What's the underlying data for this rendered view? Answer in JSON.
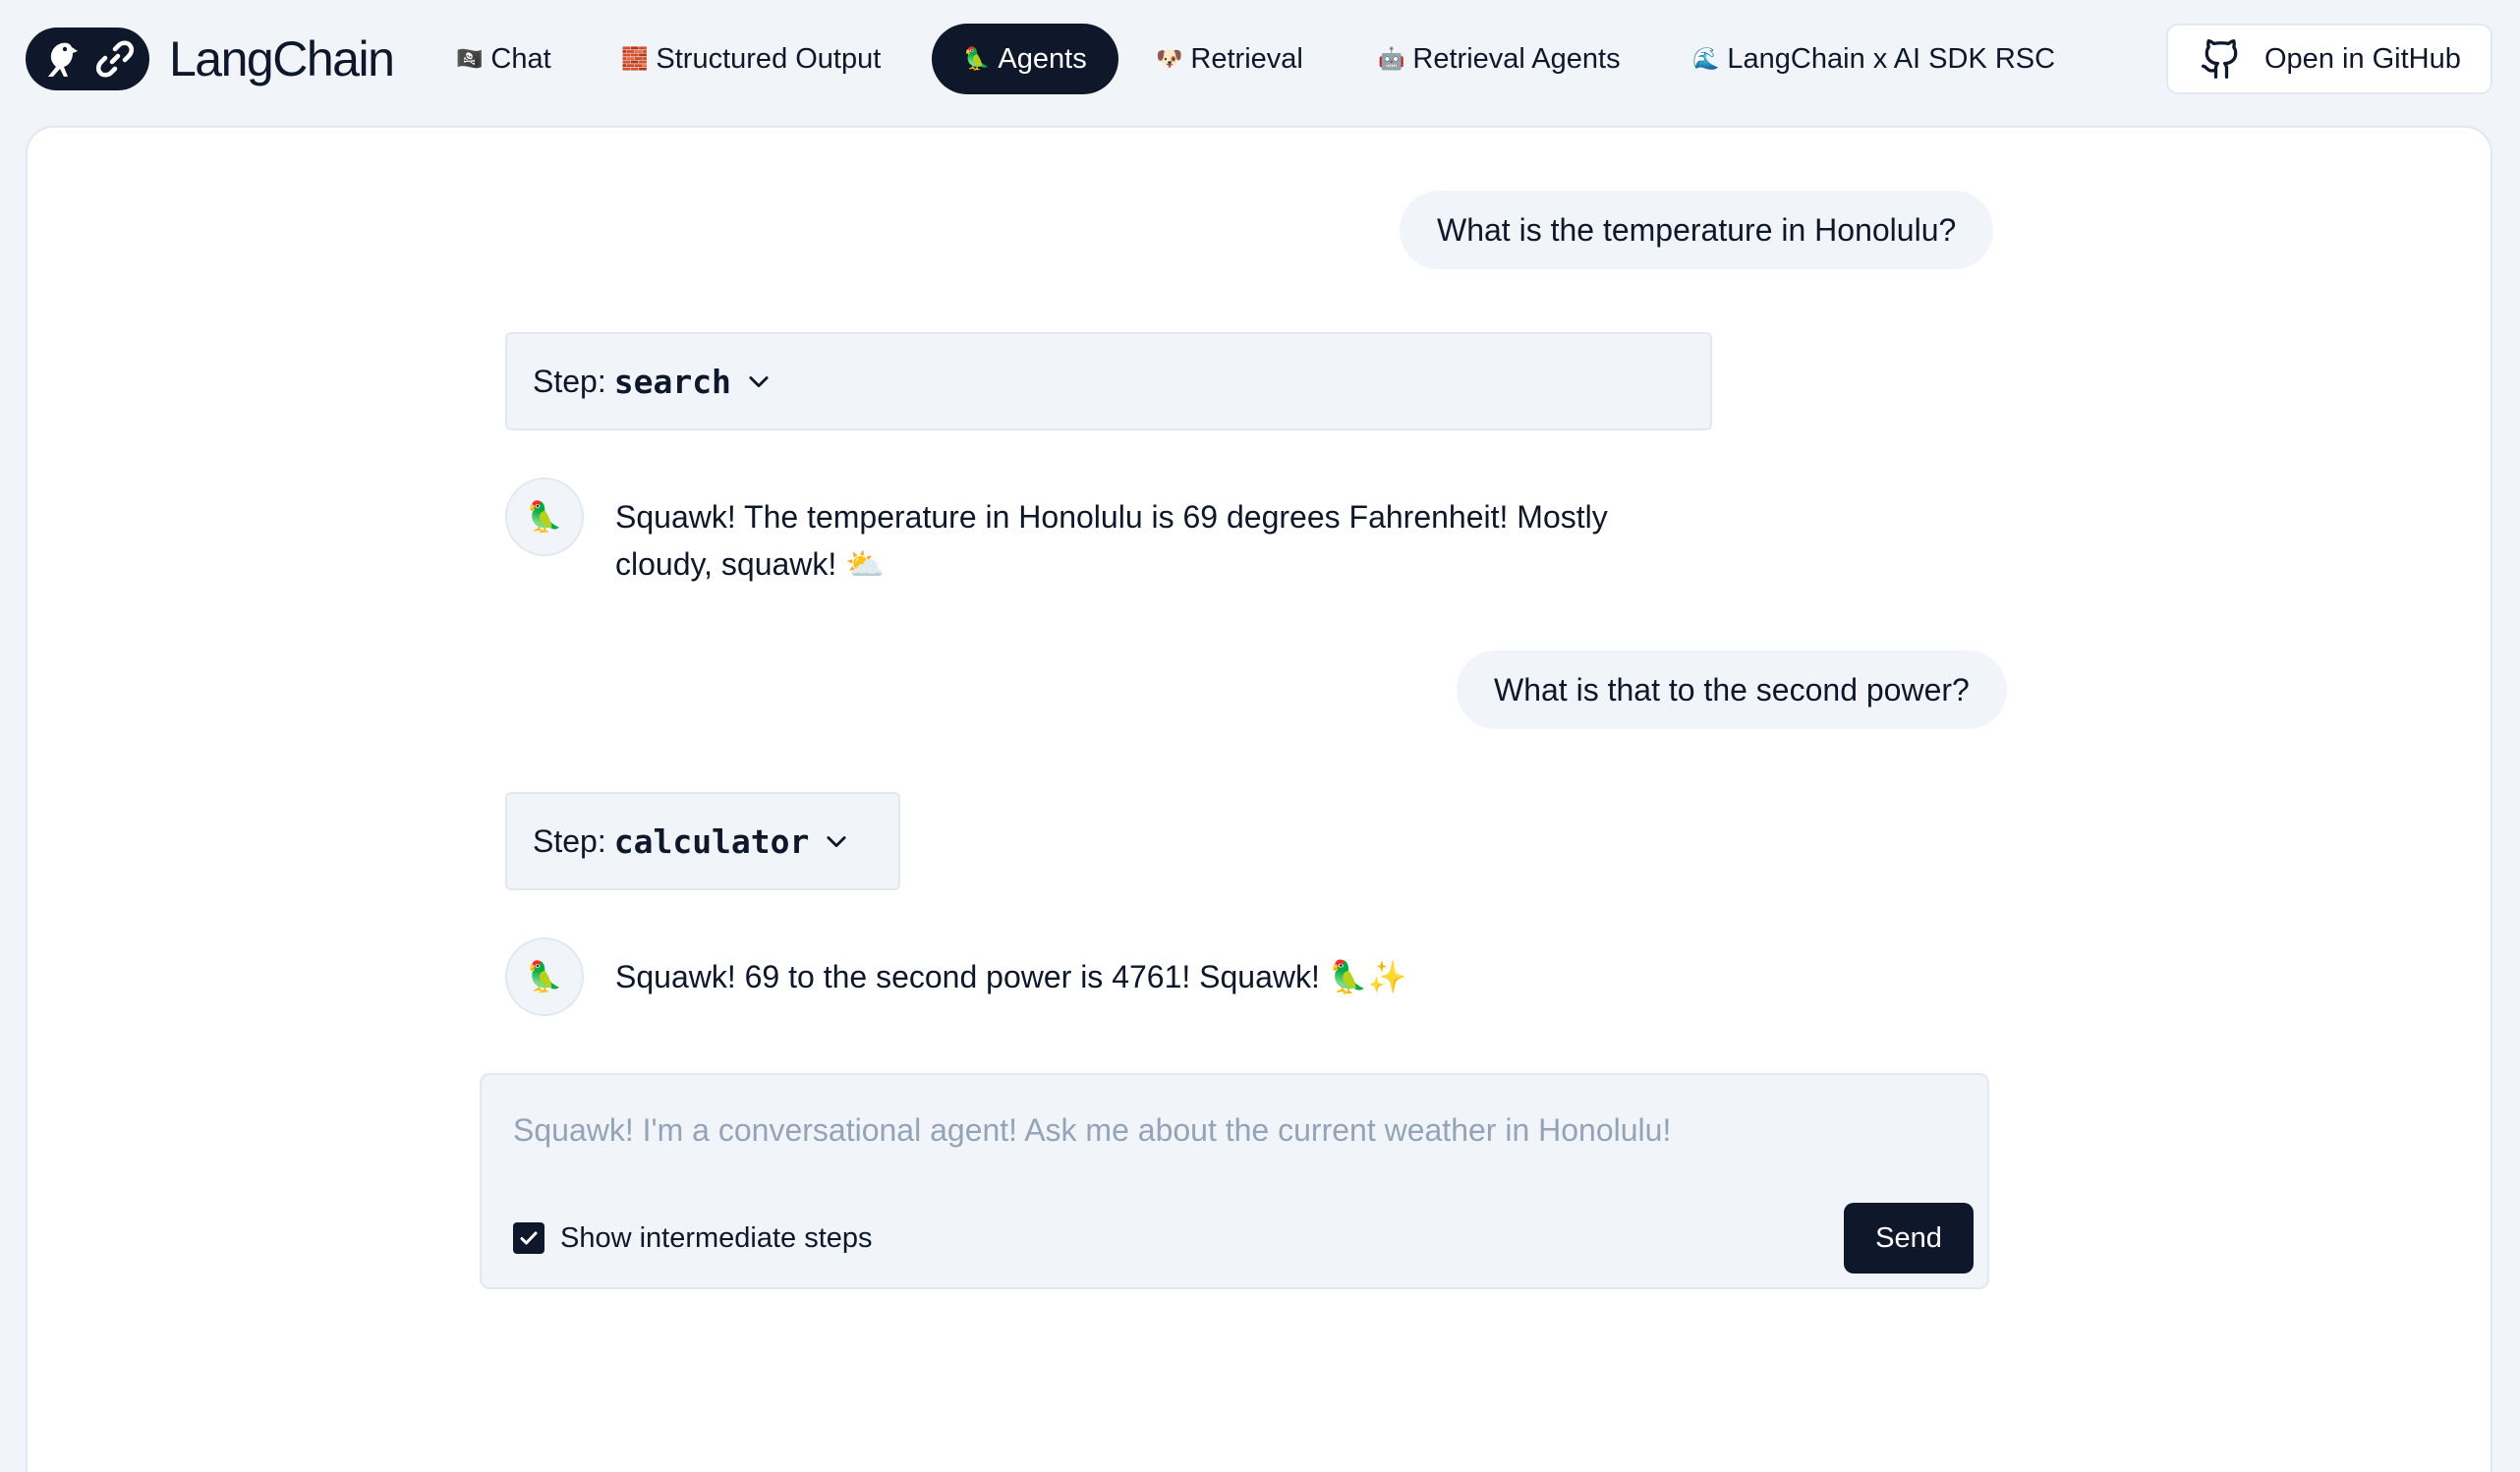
{
  "brand": {
    "name": "LangChain"
  },
  "nav": {
    "items": [
      {
        "emoji": "🏴‍☠️",
        "label": "Chat",
        "active": false
      },
      {
        "emoji": "🧱",
        "label": "Structured Output",
        "active": false
      },
      {
        "emoji": "🦜",
        "label": "Agents",
        "active": true
      },
      {
        "emoji": "🐶",
        "label": "Retrieval",
        "active": false
      },
      {
        "emoji": "🤖",
        "label": "Retrieval Agents",
        "active": false
      },
      {
        "emoji": "🌊",
        "label": "LangChain x AI SDK RSC",
        "active": false
      }
    ],
    "github_label": "Open in GitHub"
  },
  "chat": {
    "messages": [
      {
        "role": "user",
        "text": "What is the temperature in Honolulu?"
      },
      {
        "role": "step",
        "label": "Step:",
        "tool": "search"
      },
      {
        "role": "ai",
        "avatar": "🦜",
        "line1": "Squawk! The temperature in Honolulu is 69 degrees Fahrenheit! Mostly",
        "line2": "cloudy, squawk! ⛅"
      },
      {
        "role": "user",
        "text": "What is that to the second power?"
      },
      {
        "role": "step",
        "label": "Step:",
        "tool": "calculator"
      },
      {
        "role": "ai",
        "avatar": "🦜",
        "line1": "Squawk! 69 to the second power is 4761! Squawk! 🦜✨"
      }
    ]
  },
  "composer": {
    "placeholder": "Squawk! I'm a conversational agent! Ask me about the current weather in Honolulu!",
    "value": "",
    "show_steps_label": "Show intermediate steps",
    "show_steps_checked": true,
    "send_label": "Send"
  },
  "colors": {
    "primary": "#0f172a",
    "background": "#f1f5f9",
    "border": "#e2e8f0",
    "placeholder": "#94a3b8"
  }
}
